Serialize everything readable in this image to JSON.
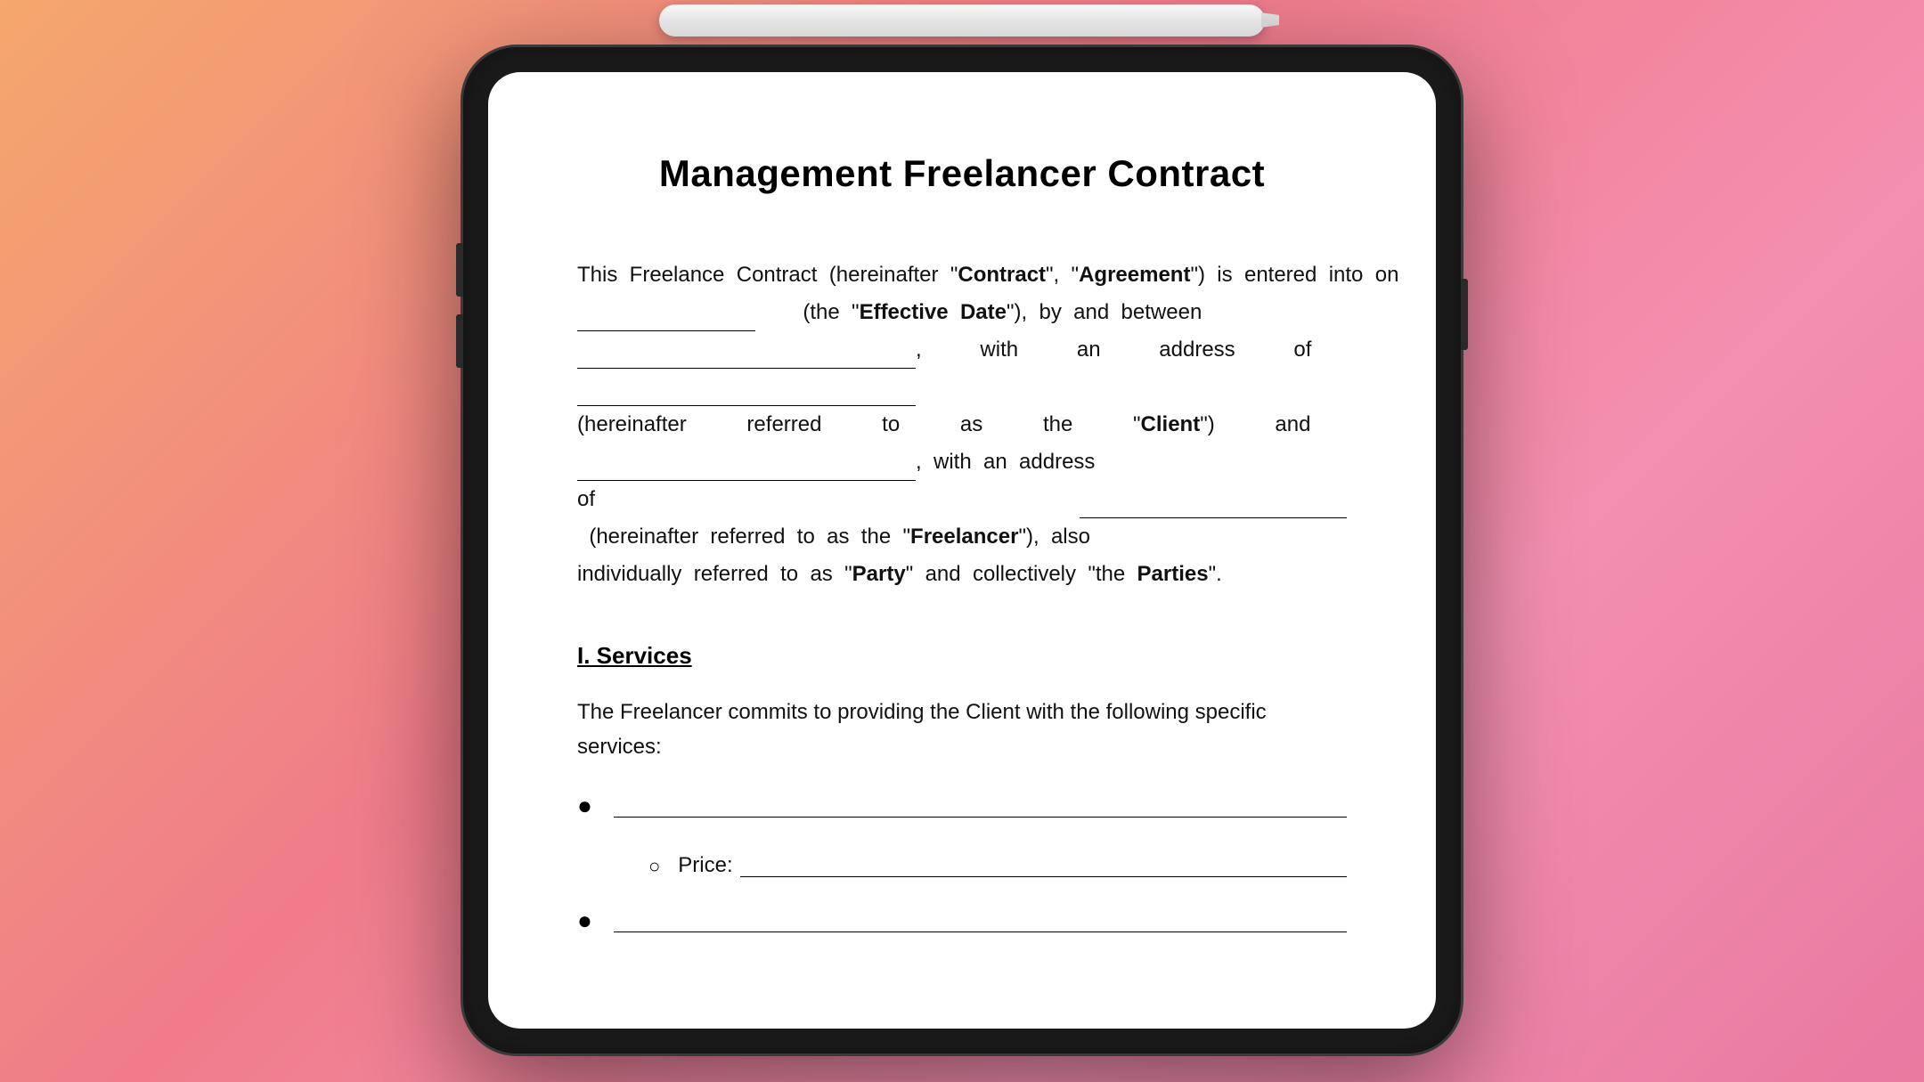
{
  "background": {
    "gradient_start": "#f5a76c",
    "gradient_end": "#e879a0"
  },
  "document": {
    "title": "Management Freelancer Contract",
    "intro": {
      "line1_pre": "This  Freelance  Contract  (hereinafter  “",
      "contract_bold": "Contract",
      "line1_mid1": "”,  “",
      "agreement_bold": "Agreement",
      "line1_mid2": "”)  is  entered  into  on",
      "blank1_label": "effective_date",
      "line2_pre": "(the  “",
      "effective_date_bold": "Effective  Date",
      "line2_mid": "”),  by  and  between",
      "blank2_label": "party1_name",
      "line3_pre": ",  with  an  address  of",
      "blank3_label": "party1_address",
      "line4_pre": "(hereinafter  referred  to  as  the  “",
      "client_bold": "Client",
      "line4_mid": "”)  and",
      "blank4_label": "party2_name",
      "line5_pre": ",  with  an  address  of",
      "blank5_label": "party2_address",
      "line6_pre": "(hereinafter  referred  to  as  the  “",
      "freelancer_bold": "Freelancer",
      "line6_mid": "”),  also  individually  referred  to  as  “",
      "party_bold": "Party",
      "line6_end1": "”  and  collectively  “the  ",
      "parties_bold": "Parties",
      "line6_end2": "”."
    },
    "section1": {
      "heading": "I. Services",
      "intro_text": "The Freelancer commits to providing the Client with the following specific services:",
      "bullet1_label": "",
      "sub_bullet1_label": "Price:",
      "bullet2_label": ""
    }
  }
}
